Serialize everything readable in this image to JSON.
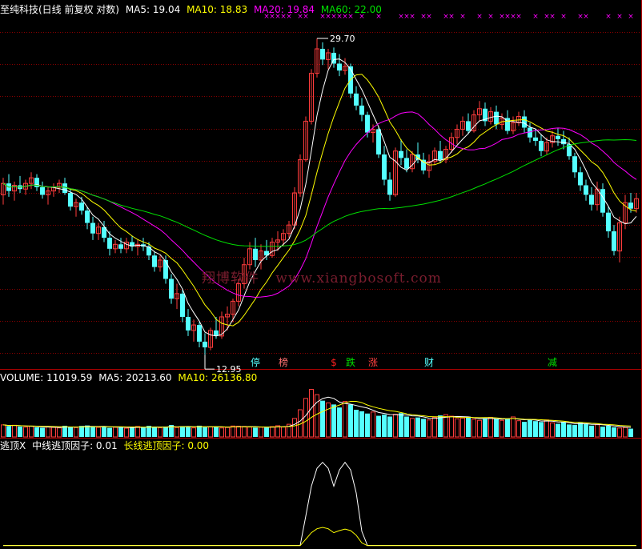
{
  "price_header": {
    "title": "至纯科技(日线 前复权 对数)",
    "ma5": "MA5: 19.04",
    "ma10": "MA10: 18.83",
    "ma20": "MA20: 19.84",
    "ma60": "MA60: 22.00"
  },
  "volume_header": {
    "volume": "VOLUME: 11019.59",
    "ma5": "MA5: 20213.60",
    "ma10": "MA10: 26136.80"
  },
  "indicator_header": {
    "name": "逃顶X",
    "mid": "中线逃顶因子: 0.01",
    "long": "长线逃顶因子: 0.00"
  },
  "watermark": {
    "cn": "翔博软件",
    "url": "www.xiangbosoft.com"
  },
  "colors": {
    "up": "#ff3c3c",
    "down": "#54ffff",
    "ma5": "#ffffff",
    "ma10": "#ffff00",
    "ma20": "#ff00ff",
    "ma60": "#00e000",
    "grid": "#8b0000",
    "axis": "#b00000"
  },
  "chart_data": [
    {
      "type": "candlestick",
      "title": "至纯科技(日线 前复权 对数)",
      "ylim": [
        12.5,
        31.5
      ],
      "log_scale": true,
      "grid": true,
      "high_label": "29.70",
      "low_label": "12.95",
      "signal_markers": [
        "停",
        "榜",
        "$",
        "跌",
        "涨",
        "财",
        "减"
      ],
      "series": [
        {
          "name": "MA5",
          "value": 19.04
        },
        {
          "name": "MA10",
          "value": 18.83
        },
        {
          "name": "MA20",
          "value": 19.84
        },
        {
          "name": "MA60",
          "value": 22.0
        }
      ],
      "ohlc": [
        [
          19.7,
          20.6,
          19.2,
          20.3
        ],
        [
          20.3,
          20.8,
          19.6,
          19.9
        ],
        [
          19.9,
          20.4,
          19.4,
          20.2
        ],
        [
          20.2,
          20.7,
          19.8,
          20.0
        ],
        [
          20.0,
          20.5,
          19.7,
          20.3
        ],
        [
          20.3,
          20.9,
          20.0,
          20.6
        ],
        [
          20.6,
          20.8,
          19.9,
          20.1
        ],
        [
          20.1,
          20.4,
          19.5,
          19.7
        ],
        [
          19.7,
          20.1,
          19.2,
          19.9
        ],
        [
          19.9,
          20.3,
          19.6,
          20.1
        ],
        [
          20.1,
          20.5,
          19.8,
          20.3
        ],
        [
          20.3,
          20.6,
          19.7,
          19.8
        ],
        [
          19.8,
          20.0,
          18.9,
          19.1
        ],
        [
          19.1,
          19.5,
          18.6,
          19.3
        ],
        [
          19.3,
          19.6,
          18.7,
          18.9
        ],
        [
          18.9,
          19.1,
          18.0,
          18.3
        ],
        [
          18.3,
          18.6,
          17.5,
          17.8
        ],
        [
          17.8,
          18.3,
          17.5,
          18.1
        ],
        [
          18.1,
          18.4,
          17.4,
          17.6
        ],
        [
          17.6,
          17.9,
          16.8,
          17.1
        ],
        [
          17.1,
          17.5,
          16.9,
          17.3
        ],
        [
          17.3,
          17.6,
          16.9,
          17.1
        ],
        [
          17.1,
          17.6,
          16.9,
          17.4
        ],
        [
          17.4,
          17.7,
          17.0,
          17.2
        ],
        [
          17.2,
          17.5,
          16.8,
          17.3
        ],
        [
          17.3,
          17.6,
          17.0,
          17.2
        ],
        [
          17.2,
          17.4,
          16.6,
          16.8
        ],
        [
          16.8,
          17.0,
          16.1,
          16.3
        ],
        [
          16.3,
          16.8,
          16.1,
          16.6
        ],
        [
          16.6,
          16.8,
          15.6,
          15.8
        ],
        [
          15.8,
          16.0,
          14.8,
          15.0
        ],
        [
          15.0,
          15.6,
          14.6,
          15.2
        ],
        [
          15.2,
          15.4,
          14.1,
          14.3
        ],
        [
          14.3,
          14.6,
          13.6,
          13.8
        ],
        [
          13.8,
          14.2,
          13.4,
          14.0
        ],
        [
          14.0,
          14.1,
          13.2,
          13.4
        ],
        [
          13.4,
          13.7,
          12.95,
          13.2
        ],
        [
          13.2,
          13.9,
          13.1,
          13.8
        ],
        [
          13.8,
          14.3,
          13.5,
          13.6
        ],
        [
          13.6,
          14.5,
          13.5,
          14.3
        ],
        [
          14.3,
          14.7,
          13.8,
          14.4
        ],
        [
          14.4,
          15.0,
          14.1,
          14.9
        ],
        [
          14.9,
          15.8,
          14.7,
          15.6
        ],
        [
          15.6,
          16.7,
          15.4,
          16.4
        ],
        [
          16.4,
          17.4,
          16.2,
          17.1
        ],
        [
          17.1,
          17.6,
          16.3,
          16.6
        ],
        [
          16.6,
          17.3,
          16.2,
          17.0
        ],
        [
          17.0,
          17.5,
          16.6,
          16.8
        ],
        [
          16.8,
          17.6,
          16.7,
          17.4
        ],
        [
          17.4,
          17.9,
          17.0,
          17.5
        ],
        [
          17.5,
          18.0,
          17.2,
          17.8
        ],
        [
          17.8,
          18.4,
          17.6,
          18.2
        ],
        [
          18.2,
          20.1,
          18.0,
          19.8
        ],
        [
          19.8,
          21.9,
          19.6,
          21.6
        ],
        [
          21.6,
          24.2,
          21.5,
          23.9
        ],
        [
          23.9,
          27.4,
          23.7,
          27.1
        ],
        [
          27.1,
          29.7,
          26.8,
          28.9
        ],
        [
          28.9,
          29.4,
          27.7,
          28.1
        ],
        [
          28.1,
          28.9,
          27.4,
          28.6
        ],
        [
          28.6,
          29.0,
          27.5,
          27.8
        ],
        [
          27.8,
          28.5,
          26.9,
          27.3
        ],
        [
          27.3,
          28.2,
          27.0,
          27.6
        ],
        [
          27.6,
          27.8,
          25.4,
          25.7
        ],
        [
          25.7,
          26.2,
          24.6,
          24.9
        ],
        [
          24.9,
          25.4,
          23.9,
          24.3
        ],
        [
          24.3,
          24.5,
          22.9,
          23.2
        ],
        [
          23.2,
          23.7,
          22.6,
          23.4
        ],
        [
          23.4,
          23.6,
          21.7,
          21.9
        ],
        [
          21.9,
          22.4,
          20.2,
          20.5
        ],
        [
          20.5,
          20.9,
          19.4,
          19.7
        ],
        [
          19.7,
          22.3,
          19.6,
          22.1
        ],
        [
          22.1,
          22.8,
          21.3,
          21.7
        ],
        [
          21.7,
          22.2,
          20.9,
          21.1
        ],
        [
          21.1,
          22.1,
          20.9,
          21.9
        ],
        [
          21.9,
          22.6,
          21.4,
          21.6
        ],
        [
          21.6,
          22.0,
          20.8,
          21.0
        ],
        [
          21.0,
          21.9,
          20.6,
          21.5
        ],
        [
          21.5,
          22.3,
          21.3,
          22.1
        ],
        [
          22.1,
          22.7,
          21.4,
          21.6
        ],
        [
          21.6,
          22.4,
          21.4,
          22.2
        ],
        [
          22.2,
          23.2,
          22.0,
          22.9
        ],
        [
          22.9,
          23.7,
          22.5,
          23.4
        ],
        [
          23.4,
          24.2,
          23.0,
          23.9
        ],
        [
          23.9,
          24.4,
          23.1,
          23.3
        ],
        [
          23.3,
          24.6,
          23.2,
          24.3
        ],
        [
          24.3,
          25.2,
          23.9,
          24.7
        ],
        [
          24.7,
          25.1,
          23.6,
          23.9
        ],
        [
          23.9,
          24.8,
          23.7,
          24.5
        ],
        [
          24.5,
          24.9,
          23.4,
          23.7
        ],
        [
          23.7,
          24.4,
          23.4,
          24.1
        ],
        [
          24.1,
          24.6,
          23.1,
          23.3
        ],
        [
          23.3,
          24.2,
          23.1,
          23.8
        ],
        [
          23.8,
          24.5,
          23.6,
          24.2
        ],
        [
          24.2,
          24.6,
          23.2,
          23.5
        ],
        [
          23.5,
          23.8,
          22.6,
          22.9
        ],
        [
          22.9,
          23.4,
          22.4,
          22.7
        ],
        [
          22.7,
          23.1,
          21.8,
          22.1
        ],
        [
          22.1,
          22.9,
          21.9,
          22.6
        ],
        [
          22.6,
          23.3,
          22.3,
          23.0
        ],
        [
          23.0,
          23.5,
          22.4,
          22.8
        ],
        [
          22.8,
          23.3,
          22.2,
          22.5
        ],
        [
          22.5,
          22.9,
          21.6,
          21.8
        ],
        [
          21.8,
          22.0,
          20.6,
          20.9
        ],
        [
          20.9,
          21.2,
          19.9,
          20.2
        ],
        [
          20.2,
          20.5,
          19.4,
          19.7
        ],
        [
          19.7,
          20.1,
          18.9,
          19.2
        ],
        [
          19.2,
          20.4,
          18.9,
          20.0
        ],
        [
          20.0,
          20.3,
          18.6,
          18.8
        ],
        [
          18.8,
          19.1,
          17.6,
          17.9
        ],
        [
          17.9,
          18.2,
          16.8,
          17.0
        ],
        [
          17.0,
          18.6,
          16.5,
          18.3
        ],
        [
          18.3,
          19.7,
          18.0,
          19.3
        ],
        [
          19.3,
          19.8,
          18.8,
          19.0
        ],
        [
          19.0,
          19.8,
          18.8,
          19.5
        ]
      ]
    },
    {
      "type": "bar",
      "title": "VOLUME",
      "series": [
        {
          "name": "VOLUME",
          "value": 11019.59
        },
        {
          "name": "MA5",
          "value": 20213.6
        },
        {
          "name": "MA10",
          "value": 26136.8
        }
      ],
      "ylim": [
        0,
        72000
      ],
      "values": [
        16000,
        14500,
        15500,
        13800,
        13000,
        14200,
        12800,
        12200,
        13500,
        12600,
        12000,
        14800,
        13200,
        12500,
        14600,
        15200,
        13800,
        12700,
        14000,
        12100,
        12800,
        13300,
        11600,
        12600,
        13900,
        12300,
        14700,
        12900,
        12100,
        13600,
        15800,
        12500,
        14200,
        13500,
        12000,
        14900,
        12700,
        13400,
        13800,
        11900,
        12600,
        14500,
        14200,
        13900,
        13100,
        12400,
        12800,
        12500,
        13700,
        14900,
        13100,
        16800,
        24500,
        36000,
        51000,
        63000,
        56000,
        48000,
        45000,
        43000,
        39000,
        47000,
        43000,
        36000,
        34000,
        31000,
        33000,
        28000,
        29500,
        27000,
        30000,
        31500,
        27000,
        24500,
        25800,
        24000,
        22500,
        26000,
        28500,
        29500,
        27500,
        24000,
        25000,
        26800,
        23500,
        22000,
        24500,
        26000,
        23800,
        22000,
        24000,
        26500,
        21500,
        20000,
        22800,
        21000,
        19800,
        22500,
        18600,
        17400,
        19500,
        16500,
        16000,
        18800,
        17200,
        15000,
        16200,
        13600,
        14800,
        12700,
        11800,
        12500,
        11019.59
      ]
    },
    {
      "type": "line",
      "title": "逃顶X",
      "series": [
        {
          "name": "中线逃顶因子",
          "value": 0.01
        },
        {
          "name": "长线逃顶因子",
          "value": 0.0
        }
      ],
      "ylim": [
        0,
        1.15
      ],
      "peaks": [
        {
          "center": 57,
          "width": 1.7,
          "mid": 1.0,
          "long": 0.22
        },
        {
          "center": 61,
          "width": 1.5,
          "mid": 1.0,
          "long": 0.2
        }
      ]
    }
  ]
}
